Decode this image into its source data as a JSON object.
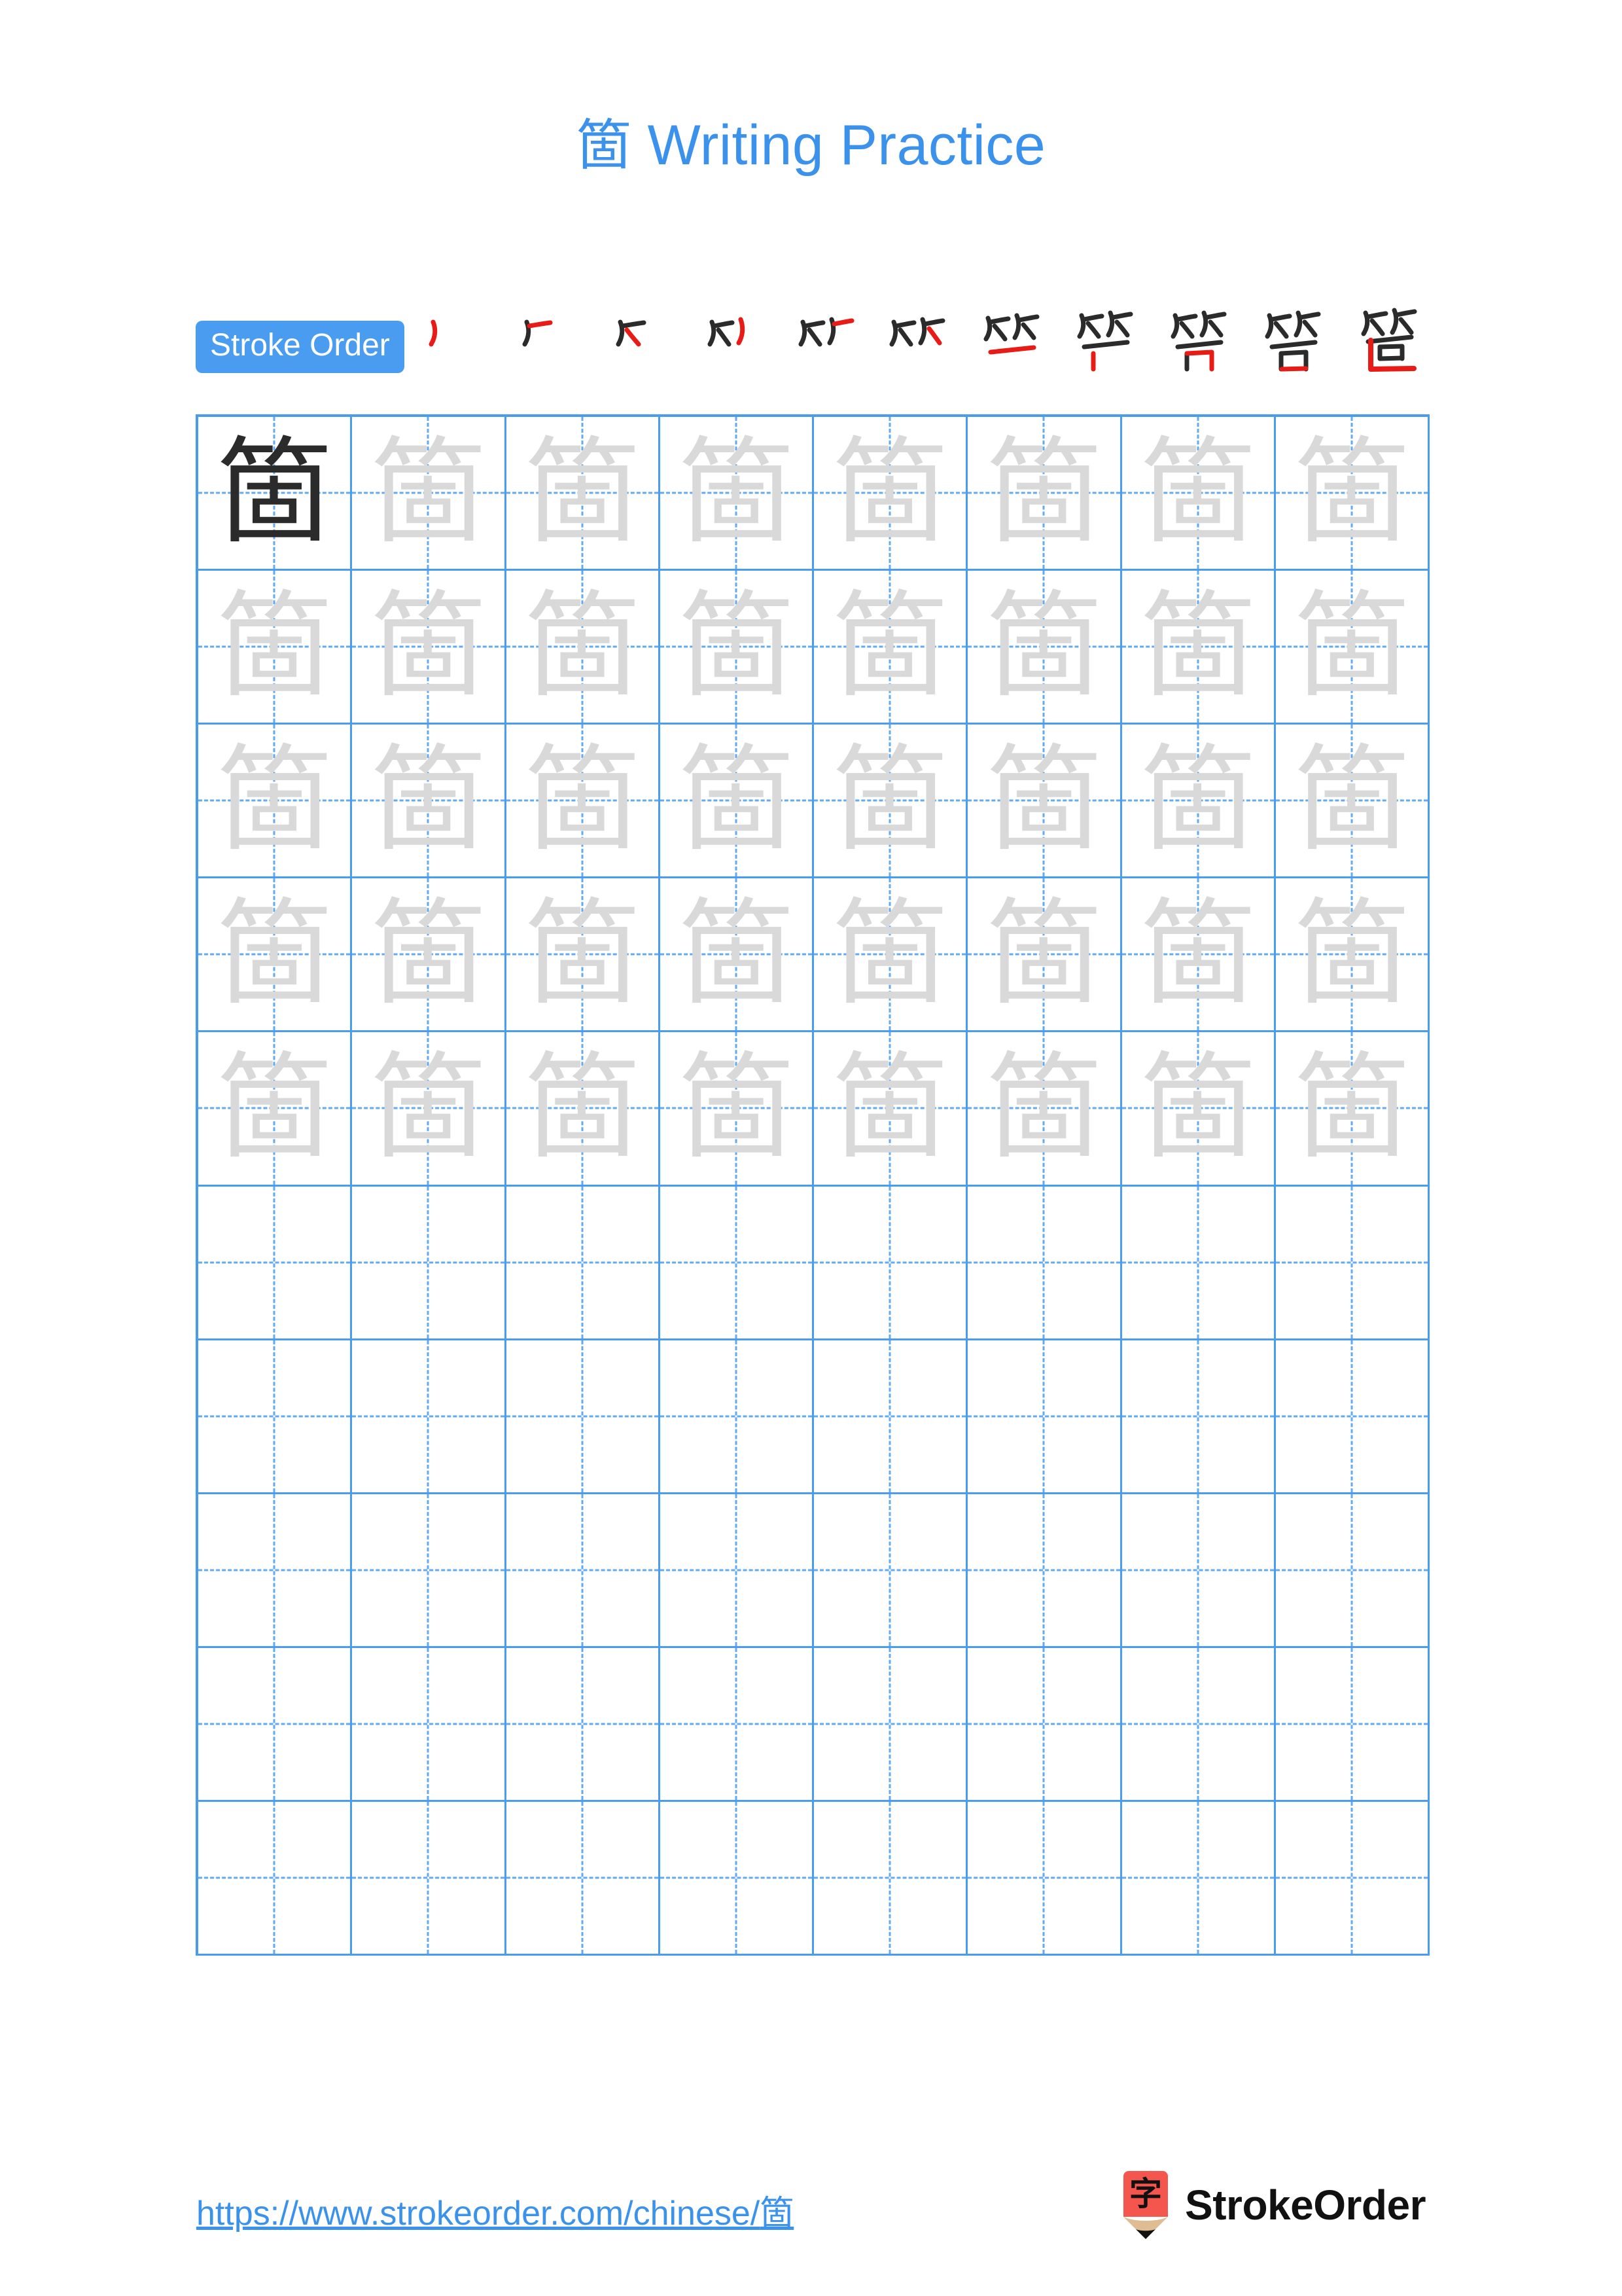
{
  "character": "箇",
  "header": {
    "title_char": "箇",
    "title_text": " Writing Practice"
  },
  "stroke_order": {
    "badge_label": "Stroke Order",
    "total_strokes": 11,
    "accent_color": "#4a9cf0",
    "new_stroke_color": "#e81b17",
    "existing_stroke_color": "#2b2b2b",
    "steps": [
      {
        "index": 1,
        "label": "stroke-1"
      },
      {
        "index": 2,
        "label": "stroke-2"
      },
      {
        "index": 3,
        "label": "stroke-3"
      },
      {
        "index": 4,
        "label": "stroke-4"
      },
      {
        "index": 5,
        "label": "stroke-5"
      },
      {
        "index": 6,
        "label": "stroke-6"
      },
      {
        "index": 7,
        "label": "stroke-7"
      },
      {
        "index": 8,
        "label": "stroke-8"
      },
      {
        "index": 9,
        "label": "stroke-9"
      },
      {
        "index": 10,
        "label": "stroke-10"
      },
      {
        "index": 11,
        "label": "stroke-11"
      }
    ]
  },
  "practice_grid": {
    "columns": 8,
    "rows": 10,
    "grid_line_color": "#4a9cf0",
    "guide_line_color": "#62aaf2",
    "traced_char_color": "#d9d9d9",
    "model_char_color": "#2b2b2b",
    "cells": [
      {
        "char": "箇",
        "style": "dark"
      },
      {
        "char": "箇",
        "style": "light"
      },
      {
        "char": "箇",
        "style": "light"
      },
      {
        "char": "箇",
        "style": "light"
      },
      {
        "char": "箇",
        "style": "light"
      },
      {
        "char": "箇",
        "style": "light"
      },
      {
        "char": "箇",
        "style": "light"
      },
      {
        "char": "箇",
        "style": "light"
      },
      {
        "char": "箇",
        "style": "light"
      },
      {
        "char": "箇",
        "style": "light"
      },
      {
        "char": "箇",
        "style": "light"
      },
      {
        "char": "箇",
        "style": "light"
      },
      {
        "char": "箇",
        "style": "light"
      },
      {
        "char": "箇",
        "style": "light"
      },
      {
        "char": "箇",
        "style": "light"
      },
      {
        "char": "箇",
        "style": "light"
      },
      {
        "char": "箇",
        "style": "light"
      },
      {
        "char": "箇",
        "style": "light"
      },
      {
        "char": "箇",
        "style": "light"
      },
      {
        "char": "箇",
        "style": "light"
      },
      {
        "char": "箇",
        "style": "light"
      },
      {
        "char": "箇",
        "style": "light"
      },
      {
        "char": "箇",
        "style": "light"
      },
      {
        "char": "箇",
        "style": "light"
      },
      {
        "char": "箇",
        "style": "light"
      },
      {
        "char": "箇",
        "style": "light"
      },
      {
        "char": "箇",
        "style": "light"
      },
      {
        "char": "箇",
        "style": "light"
      },
      {
        "char": "箇",
        "style": "light"
      },
      {
        "char": "箇",
        "style": "light"
      },
      {
        "char": "箇",
        "style": "light"
      },
      {
        "char": "箇",
        "style": "light"
      },
      {
        "char": "箇",
        "style": "light"
      },
      {
        "char": "箇",
        "style": "light"
      },
      {
        "char": "箇",
        "style": "light"
      },
      {
        "char": "箇",
        "style": "light"
      },
      {
        "char": "箇",
        "style": "light"
      },
      {
        "char": "箇",
        "style": "light"
      },
      {
        "char": "箇",
        "style": "light"
      },
      {
        "char": "箇",
        "style": "light"
      },
      {
        "char": "",
        "style": "empty"
      },
      {
        "char": "",
        "style": "empty"
      },
      {
        "char": "",
        "style": "empty"
      },
      {
        "char": "",
        "style": "empty"
      },
      {
        "char": "",
        "style": "empty"
      },
      {
        "char": "",
        "style": "empty"
      },
      {
        "char": "",
        "style": "empty"
      },
      {
        "char": "",
        "style": "empty"
      },
      {
        "char": "",
        "style": "empty"
      },
      {
        "char": "",
        "style": "empty"
      },
      {
        "char": "",
        "style": "empty"
      },
      {
        "char": "",
        "style": "empty"
      },
      {
        "char": "",
        "style": "empty"
      },
      {
        "char": "",
        "style": "empty"
      },
      {
        "char": "",
        "style": "empty"
      },
      {
        "char": "",
        "style": "empty"
      },
      {
        "char": "",
        "style": "empty"
      },
      {
        "char": "",
        "style": "empty"
      },
      {
        "char": "",
        "style": "empty"
      },
      {
        "char": "",
        "style": "empty"
      },
      {
        "char": "",
        "style": "empty"
      },
      {
        "char": "",
        "style": "empty"
      },
      {
        "char": "",
        "style": "empty"
      },
      {
        "char": "",
        "style": "empty"
      },
      {
        "char": "",
        "style": "empty"
      },
      {
        "char": "",
        "style": "empty"
      },
      {
        "char": "",
        "style": "empty"
      },
      {
        "char": "",
        "style": "empty"
      },
      {
        "char": "",
        "style": "empty"
      },
      {
        "char": "",
        "style": "empty"
      },
      {
        "char": "",
        "style": "empty"
      },
      {
        "char": "",
        "style": "empty"
      },
      {
        "char": "",
        "style": "empty"
      },
      {
        "char": "",
        "style": "empty"
      },
      {
        "char": "",
        "style": "empty"
      },
      {
        "char": "",
        "style": "empty"
      },
      {
        "char": "",
        "style": "empty"
      },
      {
        "char": "",
        "style": "empty"
      },
      {
        "char": "",
        "style": "empty"
      },
      {
        "char": "",
        "style": "empty"
      }
    ]
  },
  "footer": {
    "url_prefix": "https://www.strokeorder.com/chinese/",
    "url_char": "箇",
    "brand_name": "StrokeOrder",
    "logo_char": "字",
    "logo_body_color": "#f4564e",
    "logo_wood_color": "#e0bc92",
    "logo_tip_color": "#111111"
  }
}
